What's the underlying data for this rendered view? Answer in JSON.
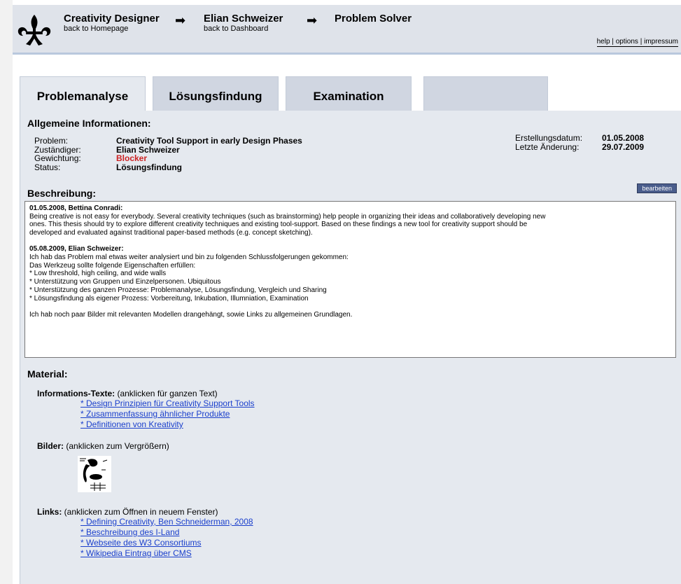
{
  "header": {
    "crumbs": [
      {
        "title": "Creativity Designer",
        "sub": "back to Homepage"
      },
      {
        "title": "Elian Schweizer",
        "sub": "back to Dashboard"
      },
      {
        "title": "Problem Solver",
        "sub": ""
      }
    ],
    "arrow": "➡",
    "toplinks": [
      "help",
      "options",
      "impressum"
    ],
    "separator": " | "
  },
  "tabs": [
    "Problemanalyse",
    "Lösungsfindung",
    "Examination",
    ""
  ],
  "general": {
    "heading": "Allgemeine Informationen:",
    "rows": [
      {
        "label": "Problem:",
        "value": "Creativity Tool Support in early Design Phases"
      },
      {
        "label": "Zuständiger:",
        "value": "Elian Schweizer"
      },
      {
        "label": "Gewichtung:",
        "value": "Blocker"
      },
      {
        "label": "Status:",
        "value": "Lösungsfindung"
      }
    ],
    "dates": [
      {
        "label": "Erstellungsdatum:",
        "value": "01.05.2008"
      },
      {
        "label": "Letzte Änderung:",
        "value": "29.07.2009"
      }
    ]
  },
  "description": {
    "heading": "Beschreibung:",
    "edit_label": "bearbeiten",
    "entries": [
      {
        "author": "01.05.2008, Bettina Conradi:",
        "lines": [
          "Being creative is not easy for everybody. Several creativity techniques (such as brainstorming) help people in organizing their ideas and collaboratively developing new",
          "ones. This thesis should try to explore different creativity techniques and existing tool-support. Based on these findings a new tool for creativity support should be",
          "developed and evaluated against traditional paper-based methods (e.g. concept sketching)."
        ]
      },
      {
        "author": "05.08.2009, Elian Schweizer:",
        "lines": [
          "Ich hab das Problem mal etwas weiter analysiert und bin zu folgenden Schlussfolgerungen gekommen:",
          "Das Werkzeug sollte folgende Eigenschaften erfüllen:",
          " * Low threshold, high ceiling, and wide walls",
          " * Unterstützung von Gruppen und Einzelpersonen. Ubiquitous",
          " * Unterstützung des ganzen Prozesse: Problemanalyse, Lösungsfindung, Vergleich und Sharing",
          " * Lösungsfindung als eigener Prozess: Vorbereitung, Inkubation, Illumniation, Examination"
        ]
      },
      {
        "author": "",
        "lines": [
          "Ich hab noch paar Bilder mit relevanten Modellen drangehängt, sowie Links zu allgemeinen Grundlagen."
        ]
      }
    ]
  },
  "material": {
    "heading": "Material:",
    "texts": {
      "label": "Informations-Texte:",
      "hint": " (anklicken für ganzen Text)",
      "items": [
        "* Design Prinzipien für Creativity Support Tools",
        "* Zusammenfassung ähnlicher Produkte",
        "* Definitionen von Kreativity"
      ]
    },
    "images": {
      "label": "Bilder:",
      "hint": " (anklicken zum Vergrößern)"
    },
    "links": {
      "label": "Links:",
      "hint": " (anklicken zum Öffnen in neuem Fenster)",
      "items": [
        "* Defining Creativity, Ben Schneiderman, 2008",
        "* Beschreibung des I-Land",
        "* Webseite des W3 Consortiums",
        "* Wikipedia Eintrag über CMS"
      ]
    }
  }
}
